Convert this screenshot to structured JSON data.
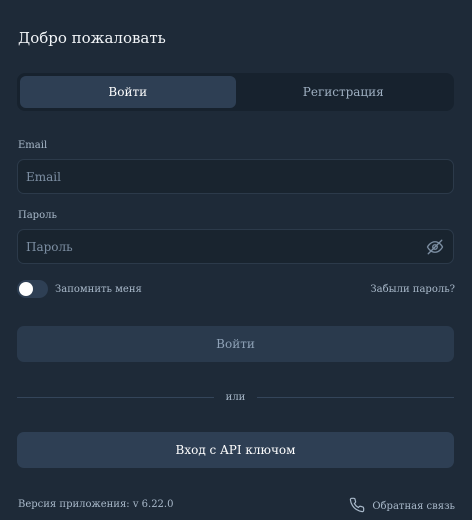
{
  "header": {
    "title": "Добро пожаловать"
  },
  "tabs": [
    {
      "label": "Войти",
      "active": true
    },
    {
      "label": "Регистрация",
      "active": false
    }
  ],
  "email": {
    "label": "Email",
    "placeholder": "Email",
    "value": ""
  },
  "password": {
    "label": "Пароль",
    "placeholder": "Пароль",
    "value": "",
    "toggle_icon": "eye-off-icon"
  },
  "remember": {
    "label": "Запомнить меня",
    "checked": false
  },
  "forgot_link": "Забыли пароль?",
  "login_button": "Войти",
  "divider_text": "или",
  "api_button": "Вход с API ключом",
  "footer": {
    "version": "Версия приложения: v 6.22.0",
    "feedback": "Обратная связь",
    "feedback_icon": "phone-icon"
  }
}
